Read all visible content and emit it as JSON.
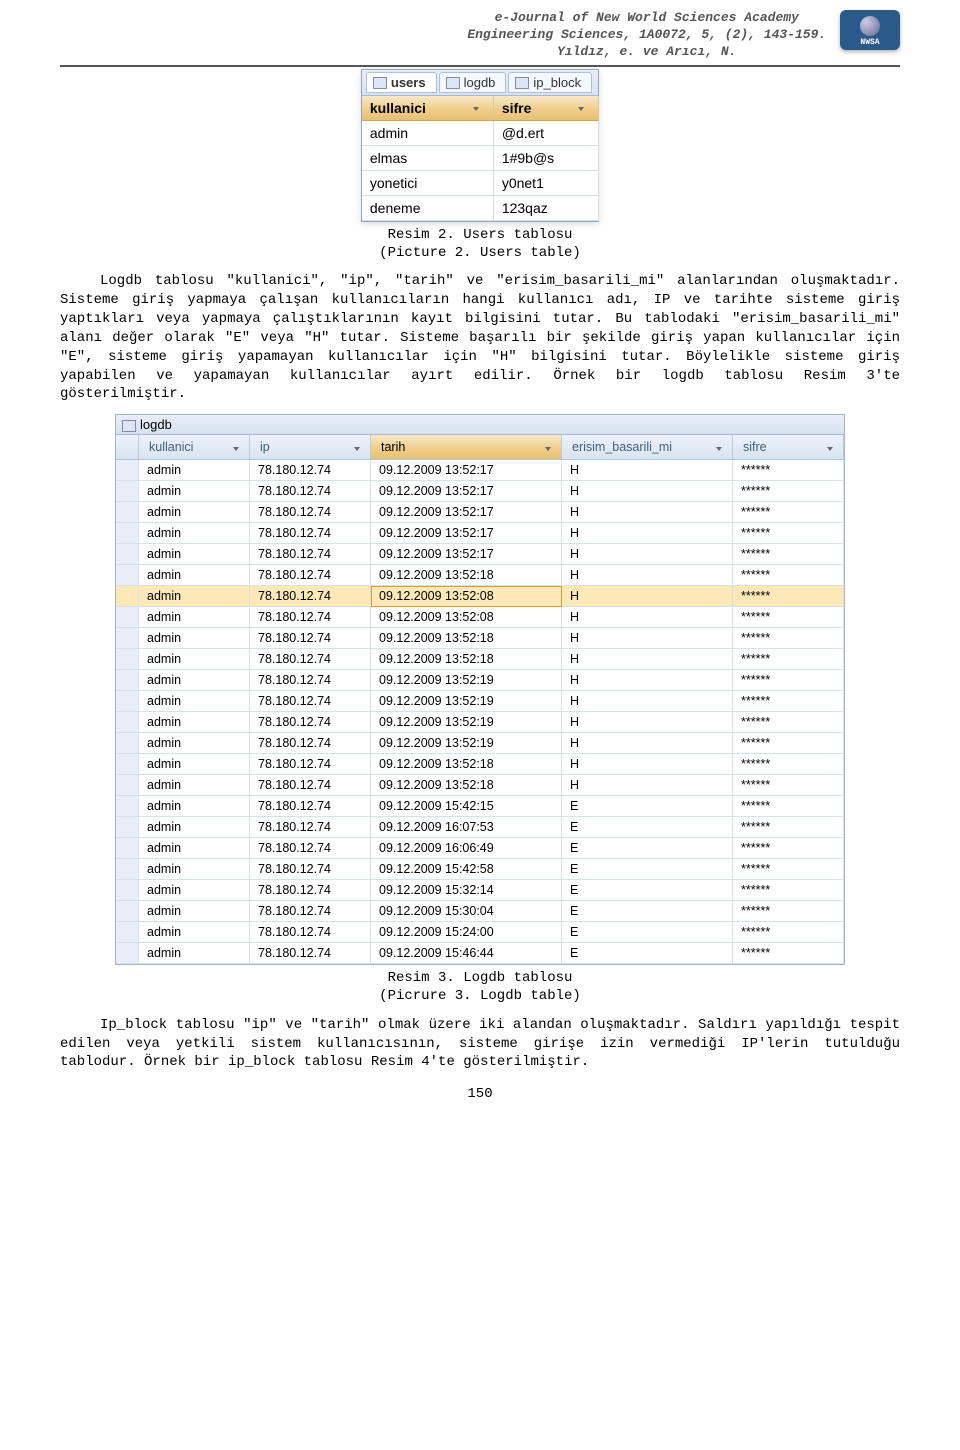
{
  "header": {
    "line1": "e-Journal of New World Sciences Academy",
    "line2": "Engineering Sciences, 1A0072, 5, (2), 143-159.",
    "line3": "Yıldız, e. ve Arıcı, N."
  },
  "caption1_line1": "Resim 2. Users tablosu",
  "caption1_line2": "(Picture 2. Users table)",
  "para1": "Logdb tablosu \"kullanici\", \"ip\", \"tarih\" ve \"erisim_basarili_mi\" alanlarından oluşmaktadır. Sisteme giriş yapmaya çalışan kullanıcıların hangi kullanıcı adı, IP ve tarihte sisteme giriş yaptıkları veya yapmaya çalıştıklarının kayıt bilgisini tutar. Bu tablodaki \"erisim_basarili_mi\" alanı değer olarak \"E\" veya \"H\" tutar. Sisteme başarılı bir şekilde giriş yapan kullanıcılar için \"E\", sisteme giriş yapamayan kullanıcılar için \"H\" bilgisini tutar. Böylelikle sisteme giriş yapabilen ve yapamayan kullanıcılar ayırt edilir. Örnek bir logdb tablosu Resim 3'te gösterilmiştir.",
  "users_table": {
    "tabs": [
      "users",
      "logdb",
      "ip_block"
    ],
    "headers": [
      "kullanici",
      "sifre"
    ],
    "rows": [
      {
        "kullanici": "admin",
        "sifre": "@d.ert"
      },
      {
        "kullanici": "elmas",
        "sifre": "1#9b@s"
      },
      {
        "kullanici": "yonetici",
        "sifre": "y0net1"
      },
      {
        "kullanici": "deneme",
        "sifre": "123qaz"
      }
    ]
  },
  "logdb_table": {
    "title": "logdb",
    "headers": [
      "kullanici",
      "ip",
      "tarih",
      "erisim_basarili_mi",
      "sifre"
    ],
    "rows": [
      {
        "k": "admin",
        "ip": "78.180.12.74",
        "t": "09.12.2009 13:52:17",
        "e": "H",
        "s": "******"
      },
      {
        "k": "admin",
        "ip": "78.180.12.74",
        "t": "09.12.2009 13:52:17",
        "e": "H",
        "s": "******"
      },
      {
        "k": "admin",
        "ip": "78.180.12.74",
        "t": "09.12.2009 13:52:17",
        "e": "H",
        "s": "******"
      },
      {
        "k": "admin",
        "ip": "78.180.12.74",
        "t": "09.12.2009 13:52:17",
        "e": "H",
        "s": "******"
      },
      {
        "k": "admin",
        "ip": "78.180.12.74",
        "t": "09.12.2009 13:52:17",
        "e": "H",
        "s": "******"
      },
      {
        "k": "admin",
        "ip": "78.180.12.74",
        "t": "09.12.2009 13:52:18",
        "e": "H",
        "s": "******"
      },
      {
        "k": "admin",
        "ip": "78.180.12.74",
        "t": "09.12.2009 13:52:08",
        "e": "H",
        "s": "******",
        "selected": true
      },
      {
        "k": "admin",
        "ip": "78.180.12.74",
        "t": "09.12.2009 13:52:08",
        "e": "H",
        "s": "******"
      },
      {
        "k": "admin",
        "ip": "78.180.12.74",
        "t": "09.12.2009 13:52:18",
        "e": "H",
        "s": "******"
      },
      {
        "k": "admin",
        "ip": "78.180.12.74",
        "t": "09.12.2009 13:52:18",
        "e": "H",
        "s": "******"
      },
      {
        "k": "admin",
        "ip": "78.180.12.74",
        "t": "09.12.2009 13:52:19",
        "e": "H",
        "s": "******"
      },
      {
        "k": "admin",
        "ip": "78.180.12.74",
        "t": "09.12.2009 13:52:19",
        "e": "H",
        "s": "******"
      },
      {
        "k": "admin",
        "ip": "78.180.12.74",
        "t": "09.12.2009 13:52:19",
        "e": "H",
        "s": "******"
      },
      {
        "k": "admin",
        "ip": "78.180.12.74",
        "t": "09.12.2009 13:52:19",
        "e": "H",
        "s": "******"
      },
      {
        "k": "admin",
        "ip": "78.180.12.74",
        "t": "09.12.2009 13:52:18",
        "e": "H",
        "s": "******"
      },
      {
        "k": "admin",
        "ip": "78.180.12.74",
        "t": "09.12.2009 13:52:18",
        "e": "H",
        "s": "******"
      },
      {
        "k": "admin",
        "ip": "78.180.12.74",
        "t": "09.12.2009 15:42:15",
        "e": "E",
        "s": "******"
      },
      {
        "k": "admin",
        "ip": "78.180.12.74",
        "t": "09.12.2009 16:07:53",
        "e": "E",
        "s": "******"
      },
      {
        "k": "admin",
        "ip": "78.180.12.74",
        "t": "09.12.2009 16:06:49",
        "e": "E",
        "s": "******"
      },
      {
        "k": "admin",
        "ip": "78.180.12.74",
        "t": "09.12.2009 15:42:58",
        "e": "E",
        "s": "******"
      },
      {
        "k": "admin",
        "ip": "78.180.12.74",
        "t": "09.12.2009 15:32:14",
        "e": "E",
        "s": "******"
      },
      {
        "k": "admin",
        "ip": "78.180.12.74",
        "t": "09.12.2009 15:30:04",
        "e": "E",
        "s": "******"
      },
      {
        "k": "admin",
        "ip": "78.180.12.74",
        "t": "09.12.2009 15:24:00",
        "e": "E",
        "s": "******"
      },
      {
        "k": "admin",
        "ip": "78.180.12.74",
        "t": "09.12.2009 15:46:44",
        "e": "E",
        "s": "******"
      }
    ]
  },
  "caption2_line1": "Resim 3. Logdb tablosu",
  "caption2_line2": "(Picrure 3. Logdb table)",
  "para2": "Ip_block tablosu \"ip\" ve \"tarih\" olmak üzere iki alandan oluşmaktadır. Saldırı yapıldığı tespit edilen veya yetkili sistem kullanıcısının, sisteme girişe izin vermediği IP'lerin tutulduğu tablodur. Örnek bir ip_block tablosu Resim 4'te gösterilmiştir.",
  "page_number": "150"
}
